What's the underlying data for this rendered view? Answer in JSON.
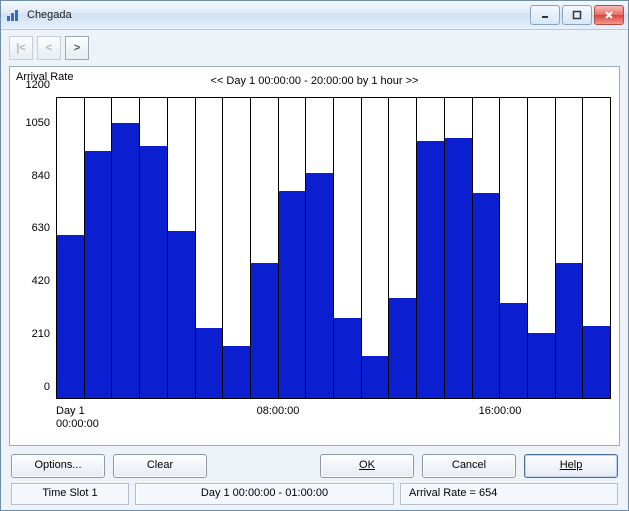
{
  "window": {
    "title": "Chegada"
  },
  "toolbar": {
    "b_rewind": "|<",
    "b_back": "<",
    "b_fwd": ">"
  },
  "chart_data": {
    "type": "bar",
    "title": "<<  Day 1  00:00:00 - 20:00:00  by 1 hour  >>",
    "ylabel": "Arrival Rate",
    "ylim": [
      0,
      1200
    ],
    "yticks": [
      0,
      210,
      420,
      630,
      840,
      1050,
      1200
    ],
    "xticks": [
      {
        "pos": 0,
        "label": "Day 1\n00:00:00"
      },
      {
        "pos": 8,
        "label": "08:00:00"
      },
      {
        "pos": 16,
        "label": "16:00:00"
      }
    ],
    "categories": [
      "0",
      "1",
      "2",
      "3",
      "4",
      "5",
      "6",
      "7",
      "8",
      "9",
      "10",
      "11",
      "12",
      "13",
      "14",
      "15",
      "16",
      "17",
      "18",
      "19"
    ],
    "values": [
      654,
      990,
      1100,
      1010,
      670,
      280,
      210,
      540,
      830,
      900,
      320,
      170,
      400,
      1030,
      1040,
      820,
      380,
      260,
      540,
      290
    ]
  },
  "buttons": {
    "options": "Options...",
    "clear": "Clear",
    "ok": "OK",
    "cancel": "Cancel",
    "help": "Help"
  },
  "status": {
    "slot": "Time Slot 1",
    "range": "Day 1  00:00:00 - 01:00:00",
    "rate": "Arrival Rate = 654"
  }
}
